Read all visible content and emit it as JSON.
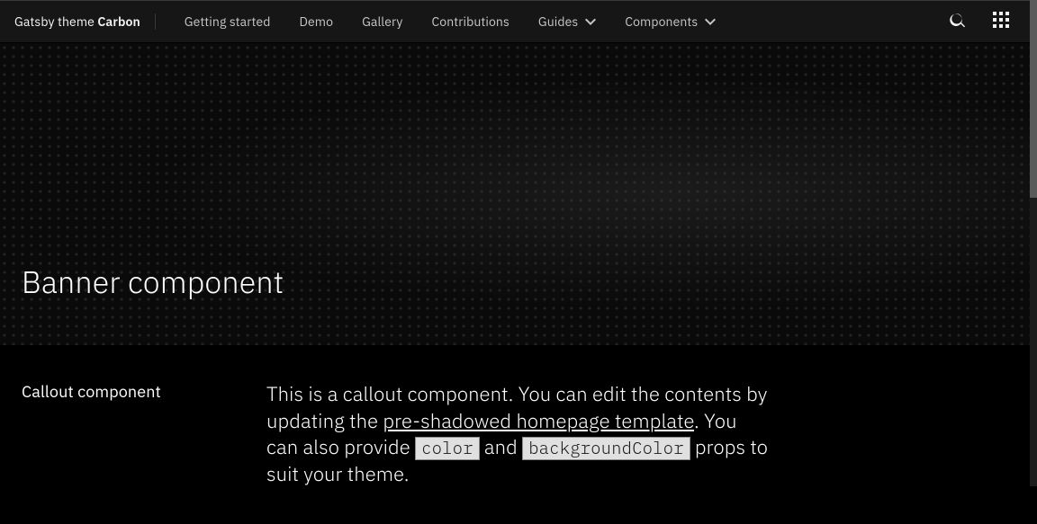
{
  "brand": {
    "normal": "Gatsby theme ",
    "bold": "Carbon"
  },
  "nav": {
    "items": [
      {
        "label": "Getting started",
        "dropdown": false
      },
      {
        "label": "Demo",
        "dropdown": false
      },
      {
        "label": "Gallery",
        "dropdown": false
      },
      {
        "label": "Contributions",
        "dropdown": false
      },
      {
        "label": "Guides",
        "dropdown": true
      },
      {
        "label": "Components",
        "dropdown": true
      }
    ]
  },
  "banner": {
    "title": "Banner component"
  },
  "callout": {
    "title": "Callout component",
    "body_part1": "This is a callout component. You can edit the contents by updating the ",
    "link_text": "pre-shadowed homepage template",
    "body_part2": ". You can also provide ",
    "code1": "color",
    "body_part3": " and ",
    "code2": "backgroundColor",
    "body_part4": " props to suit your theme."
  }
}
